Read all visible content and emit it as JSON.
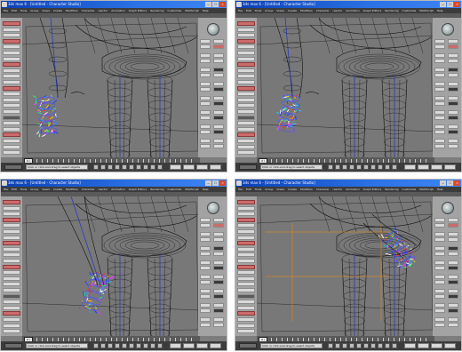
{
  "window_title": "3ds max 6 - [Untitled - Character Studio]",
  "menu_items": [
    "File",
    "Edit",
    "Tools",
    "Group",
    "Views",
    "Create",
    "Modifiers",
    "Character",
    "reactor",
    "Animation",
    "Graph Editors",
    "Rendering",
    "Customize",
    "MAXScript",
    "Help"
  ],
  "frame_counter": "0 / 100",
  "status_text": "Click or click-and-drag to select objects",
  "colors": {
    "titlebar": "#2a72e6",
    "viewport_bg": "#787878",
    "panel_bg": "#a3a3a3",
    "accent_red": "#cc6b6b",
    "bone_blue": "#2b3ab8"
  },
  "icons": {
    "close": "close-icon",
    "minimize": "minimize-icon",
    "maximize": "maximize-icon",
    "globe": "viewcube-globe-icon"
  },
  "panes": [
    {
      "id": "pane-top-left"
    },
    {
      "id": "pane-top-right"
    },
    {
      "id": "pane-bottom-left"
    },
    {
      "id": "pane-bottom-right"
    }
  ]
}
